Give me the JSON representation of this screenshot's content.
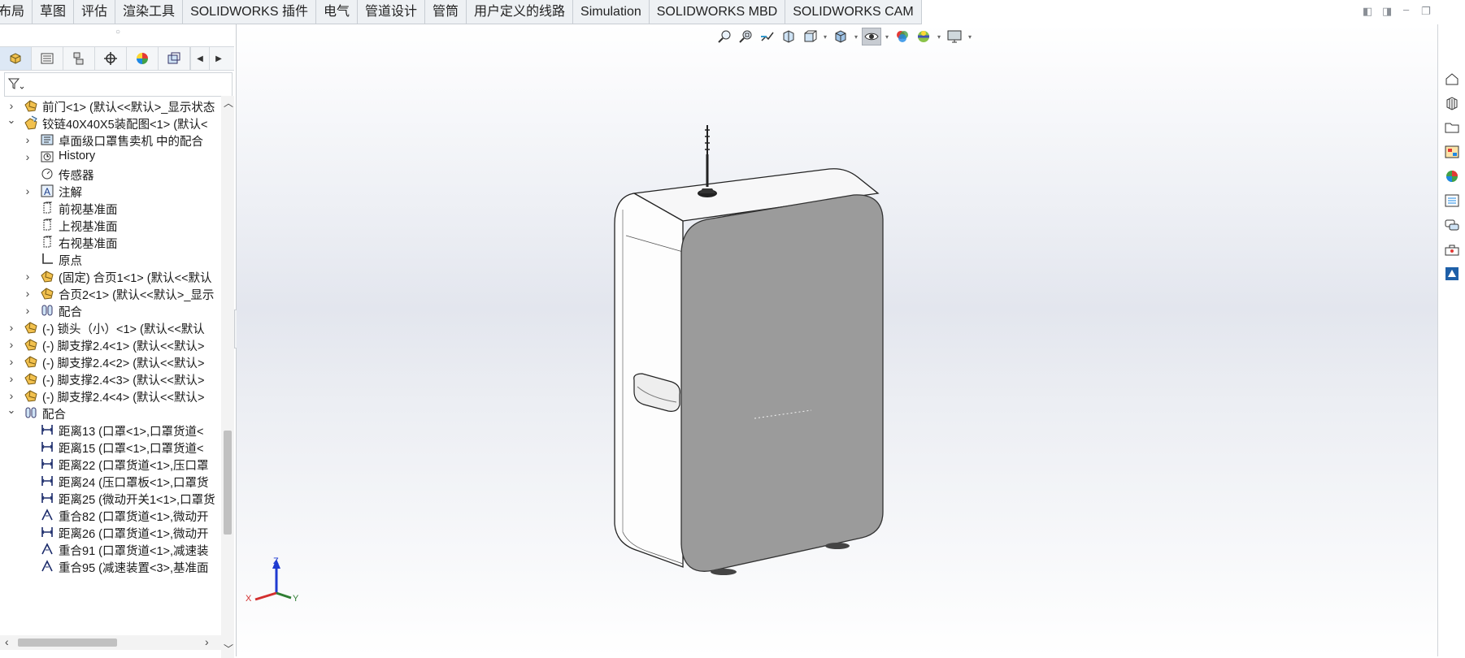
{
  "command_tabs": [
    "布局",
    "草图",
    "评估",
    "渲染工具",
    "SOLIDWORKS 插件",
    "电气",
    "管道设计",
    "管筒",
    "用户定义的线路",
    "Simulation",
    "SOLIDWORKS MBD",
    "SOLIDWORKS CAM"
  ],
  "window_controls": [
    "restore-left-icon",
    "restore-right-icon",
    "minimize-icon",
    "maximize-icon"
  ],
  "fm_tabs": [
    "featuremanager-icon",
    "propertymanager-icon",
    "configurationmanager-icon",
    "dimxpert-icon",
    "displaymanager-icon",
    "cam-icon"
  ],
  "tree": [
    {
      "label": "前门<1> (默认<<默认>_显示状态",
      "icon": "part-icon",
      "indent": 0,
      "caret": "right"
    },
    {
      "label": "铰链40X40X5装配图<1> (默认<",
      "icon": "subassembly-icon",
      "indent": 0,
      "caret": "down"
    },
    {
      "label": "卓面级口罩售卖机 中的配合",
      "icon": "mates-folder-icon",
      "indent": 1,
      "caret": "right"
    },
    {
      "label": "History",
      "icon": "history-icon",
      "indent": 1,
      "caret": "right"
    },
    {
      "label": "传感器",
      "icon": "sensor-icon",
      "indent": 1,
      "caret": ""
    },
    {
      "label": "注解",
      "icon": "annotation-icon",
      "indent": 1,
      "caret": "right"
    },
    {
      "label": "前视基准面",
      "icon": "plane-icon",
      "indent": 1,
      "caret": ""
    },
    {
      "label": "上视基准面",
      "icon": "plane-icon",
      "indent": 1,
      "caret": ""
    },
    {
      "label": "右视基准面",
      "icon": "plane-icon",
      "indent": 1,
      "caret": ""
    },
    {
      "label": "原点",
      "icon": "origin-icon",
      "indent": 1,
      "caret": ""
    },
    {
      "label": "(固定) 合页1<1> (默认<<默认",
      "icon": "part-icon",
      "indent": 1,
      "caret": "right"
    },
    {
      "label": "合页2<1> (默认<<默认>_显示",
      "icon": "part-icon",
      "indent": 1,
      "caret": "right"
    },
    {
      "label": "配合",
      "icon": "mates-icon",
      "indent": 1,
      "caret": "right"
    },
    {
      "label": "(-) 锁头（小）<1> (默认<<默认",
      "icon": "part-icon",
      "indent": 0,
      "caret": "right"
    },
    {
      "label": "(-) 脚支撑2.4<1> (默认<<默认>",
      "icon": "part-icon",
      "indent": 0,
      "caret": "right"
    },
    {
      "label": "(-) 脚支撑2.4<2> (默认<<默认>",
      "icon": "part-icon",
      "indent": 0,
      "caret": "right"
    },
    {
      "label": "(-) 脚支撑2.4<3> (默认<<默认>",
      "icon": "part-icon",
      "indent": 0,
      "caret": "right"
    },
    {
      "label": "(-) 脚支撑2.4<4> (默认<<默认>",
      "icon": "part-icon",
      "indent": 0,
      "caret": "right"
    },
    {
      "label": "配合",
      "icon": "mates-icon",
      "indent": 0,
      "caret": "down"
    },
    {
      "label": "距离13 (口罩<1>,口罩货道<",
      "icon": "distance-mate-icon",
      "indent": 1,
      "caret": ""
    },
    {
      "label": "距离15 (口罩<1>,口罩货道<",
      "icon": "distance-mate-icon",
      "indent": 1,
      "caret": ""
    },
    {
      "label": "距离22 (口罩货道<1>,压口罩",
      "icon": "distance-mate-icon",
      "indent": 1,
      "caret": ""
    },
    {
      "label": "距离24 (压口罩板<1>,口罩货",
      "icon": "distance-mate-icon",
      "indent": 1,
      "caret": ""
    },
    {
      "label": "距离25 (微动开关1<1>,口罩货",
      "icon": "distance-mate-icon",
      "indent": 1,
      "caret": ""
    },
    {
      "label": "重合82 (口罩货道<1>,微动开",
      "icon": "coincident-mate-icon",
      "indent": 1,
      "caret": ""
    },
    {
      "label": "距离26 (口罩货道<1>,微动开",
      "icon": "distance-mate-icon",
      "indent": 1,
      "caret": ""
    },
    {
      "label": "重合91 (口罩货道<1>,减速装",
      "icon": "coincident-mate-icon",
      "indent": 1,
      "caret": ""
    },
    {
      "label": "重合95 (减速装置<3>,基准面",
      "icon": "coincident-mate-icon",
      "indent": 1,
      "caret": ""
    }
  ],
  "hud_toolbar": [
    "zoom-to-fit-icon",
    "zoom-to-area-icon",
    "previous-view-icon",
    "section-view-icon",
    "view-orientation-icon",
    "display-style-icon",
    "hide-show-items-icon",
    "edit-appearance-icon",
    "apply-scene-icon",
    "view-settings-icon"
  ],
  "task_pane": [
    "solidworks-resources-icon",
    "design-library-icon",
    "file-explorer-icon",
    "view-palette-icon",
    "appearances-icon",
    "custom-properties-icon",
    "forum-icon",
    "toolbox-icon",
    "3dexperience-icon"
  ],
  "triad": {
    "x": "X",
    "y": "Y",
    "z": "Z"
  },
  "colors": {
    "tab_bg": "#eef1f4",
    "viewport_top": "#ffffff",
    "viewport_mid": "#e3e6ee",
    "panel_gray": "#9b9b9b",
    "part_yellow": "#f2c14e"
  }
}
